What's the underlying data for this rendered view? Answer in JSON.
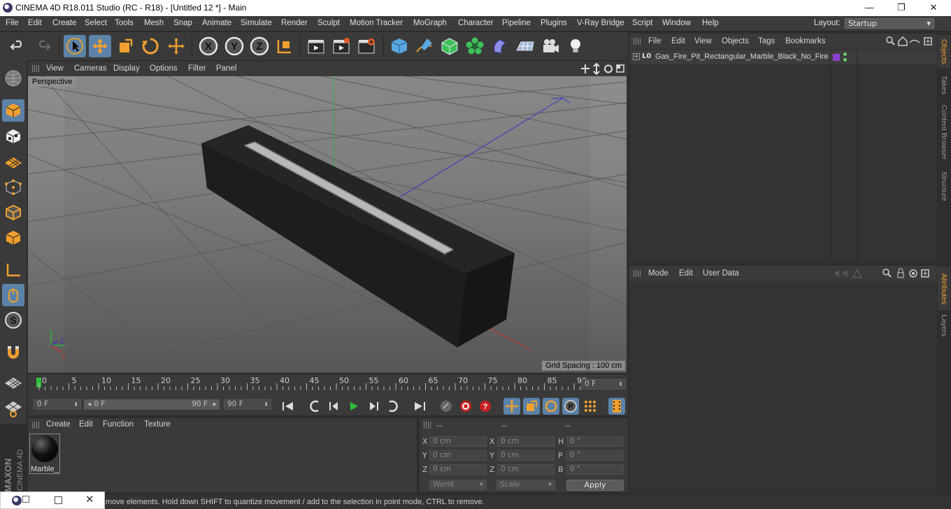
{
  "window": {
    "title": "CINEMA 4D R18.011 Studio (RC - R18) - [Untitled 12 *] - Main",
    "minimize": "—",
    "maximize": "❐",
    "close": "✕"
  },
  "menu": [
    "File",
    "Edit",
    "Create",
    "Select",
    "Tools",
    "Mesh",
    "Snap",
    "Animate",
    "Simulate",
    "Render",
    "Sculpt",
    "Motion Tracker",
    "MoGraph",
    "Character",
    "Pipeline",
    "Plugins",
    "V-Ray Bridge",
    "Script",
    "Window",
    "Help"
  ],
  "layout": {
    "label": "Layout:",
    "value": "Startup"
  },
  "toolbar": {
    "axis_x": "X",
    "axis_y": "Y",
    "axis_z": "Z"
  },
  "viewport": {
    "menu": [
      "View",
      "Cameras",
      "Display",
      "Options",
      "Filter",
      "Panel"
    ],
    "camera": "Perspective",
    "grid_spacing": "Grid Spacing : 100 cm"
  },
  "timeline": {
    "ticks": [
      "0",
      "5",
      "10",
      "15",
      "20",
      "25",
      "30",
      "35",
      "40",
      "45",
      "50",
      "55",
      "60",
      "65",
      "70",
      "75",
      "80",
      "85",
      "90"
    ],
    "current_frame": "0 F"
  },
  "transport": {
    "start": "0 F",
    "range_start": "0 F",
    "range_end": "90 F",
    "end": "90 F"
  },
  "materials": {
    "menu": [
      "Create",
      "Edit",
      "Function",
      "Texture"
    ],
    "items": [
      {
        "name": "Marble_"
      }
    ]
  },
  "coords": {
    "headers": [
      "--",
      "--",
      "--"
    ],
    "rows": [
      {
        "pl": "X",
        "pv": "0 cm",
        "sl": "X",
        "sv": "0 cm",
        "rl": "H",
        "rv": "0 °"
      },
      {
        "pl": "Y",
        "pv": "0 cm",
        "sl": "Y",
        "sv": "0 cm",
        "rl": "P",
        "rv": "0 °"
      },
      {
        "pl": "Z",
        "pv": "0 cm",
        "sl": "Z",
        "sv": "0 cm",
        "rl": "B",
        "rv": "0 °"
      }
    ],
    "mode": "World",
    "scale": "Scale",
    "apply": "Apply"
  },
  "objects": {
    "menu": [
      "File",
      "Edit",
      "View",
      "Objects",
      "Tags",
      "Bookmarks"
    ],
    "items": [
      {
        "name": "Gas_Fire_Pit_Rectangular_Marble_Black_No_Fire",
        "layer_badge": "L0"
      }
    ]
  },
  "attributes": {
    "menu": [
      "Mode",
      "Edit",
      "User Data"
    ]
  },
  "right_tabs": {
    "top": [
      "Objects",
      "Takes",
      "Content Browser",
      "Structure"
    ],
    "bottom": [
      "Attributes",
      "Layers"
    ]
  },
  "status": "move elements. Hold down SHIFT to quantize movement / add to the selection in point mode, CTRL to remove.",
  "branding": {
    "maxon": "MAXON",
    "product": "CINEMA 4D"
  },
  "colors": {
    "accent": "#5b82a8",
    "orange": "#f0a030",
    "object_tag": "#8a3fd0"
  }
}
